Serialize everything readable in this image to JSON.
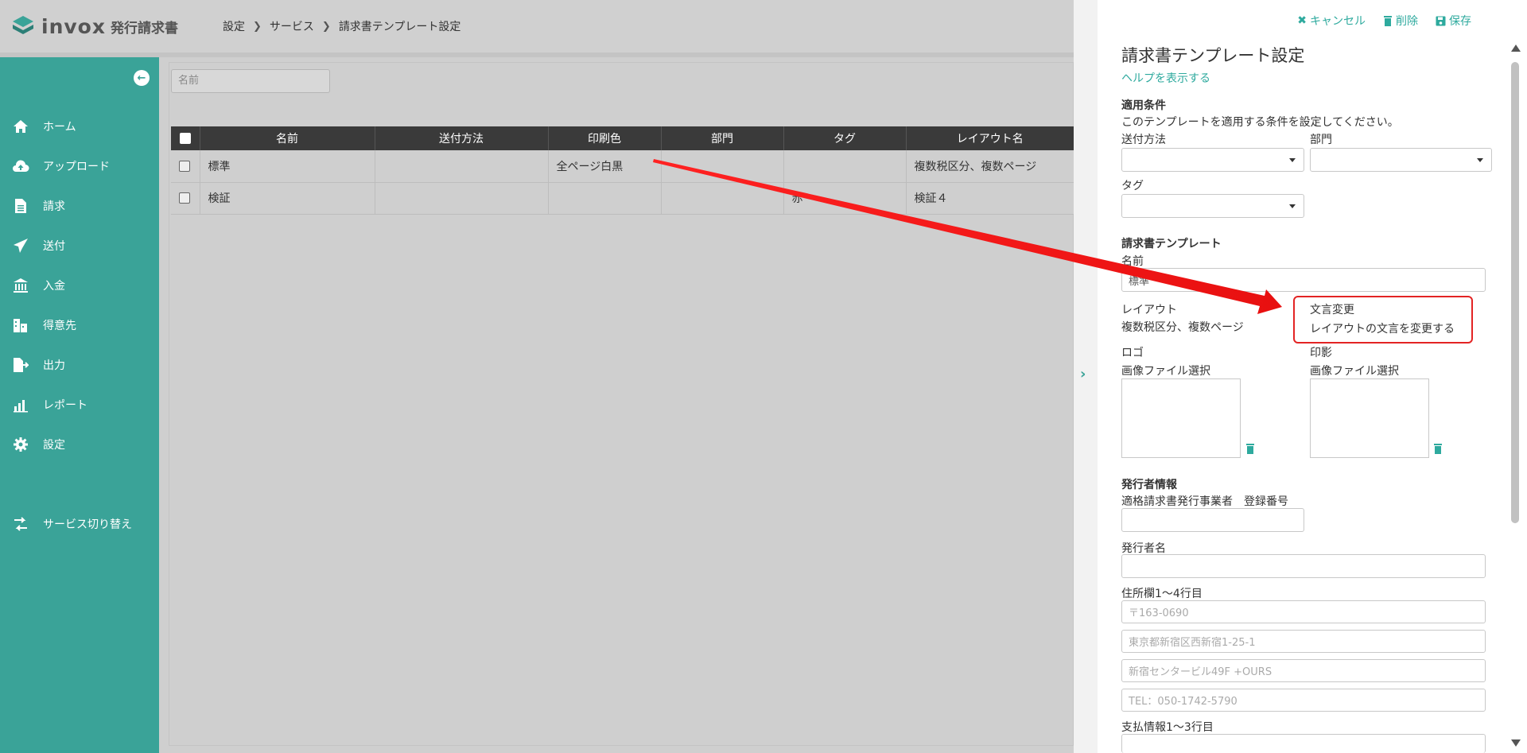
{
  "header": {
    "logo_text": "invox",
    "logo_sub": "発行請求書",
    "breadcrumb": [
      "設定",
      "サービス",
      "請求書テンプレート設定"
    ]
  },
  "sidebar": {
    "items": [
      {
        "label": "ホーム",
        "icon": "home-icon"
      },
      {
        "label": "アップロード",
        "icon": "cloud-upload-icon"
      },
      {
        "label": "請求",
        "icon": "document-icon"
      },
      {
        "label": "送付",
        "icon": "paper-plane-icon"
      },
      {
        "label": "入金",
        "icon": "bank-icon"
      },
      {
        "label": "得意先",
        "icon": "building-icon"
      },
      {
        "label": "出力",
        "icon": "file-export-icon"
      },
      {
        "label": "レポート",
        "icon": "chart-icon"
      },
      {
        "label": "設定",
        "icon": "gear-icon"
      }
    ],
    "switch_label": "サービス切り替え"
  },
  "main": {
    "filter_placeholder": "名前",
    "columns": [
      "名前",
      "送付方法",
      "印刷色",
      "部門",
      "タグ",
      "レイアウト名"
    ],
    "rows": [
      [
        "標準",
        "",
        "全ページ白黒",
        "",
        "",
        "複数税区分、複数ページ"
      ],
      [
        "検証",
        "",
        "",
        "",
        "赤",
        "検証４"
      ]
    ]
  },
  "panel": {
    "toolbar": {
      "cancel": "キャンセル",
      "delete": "削除",
      "save": "保存"
    },
    "title": "請求書テンプレート設定",
    "help_link": "ヘルプを表示する",
    "conditions": {
      "heading": "適用条件",
      "description": "このテンプレートを適用する条件を設定してください。",
      "send_method_label": "送付方法",
      "department_label": "部門",
      "tag_label": "タグ"
    },
    "template": {
      "heading": "請求書テンプレート",
      "name_label": "名前",
      "name_value": "標準",
      "layout_label": "レイアウト",
      "layout_link": "複数税区分、複数ページ",
      "wording_label": "文言変更",
      "wording_link": "レイアウトの文言を変更する",
      "logo_label": "ロゴ",
      "logo_link": "画像ファイル選択",
      "seal_label": "印影",
      "seal_link": "画像ファイル選択"
    },
    "issuer": {
      "heading": "発行者情報",
      "registration_label": "適格請求書発行事業者　登録番号",
      "issuer_name_label": "発行者名",
      "address_label": "住所欄1〜4行目",
      "address_placeholders": [
        "〒163-0690",
        "東京都新宿区西新宿1-25-1",
        "新宿センタービル49F +OURS",
        "TEL：050-1742-5790"
      ],
      "payment_label": "支払情報1〜3行目"
    }
  },
  "colors": {
    "accent": "#2eaa9e",
    "sidebar": "#3aa398",
    "annotation": "#e32424"
  }
}
